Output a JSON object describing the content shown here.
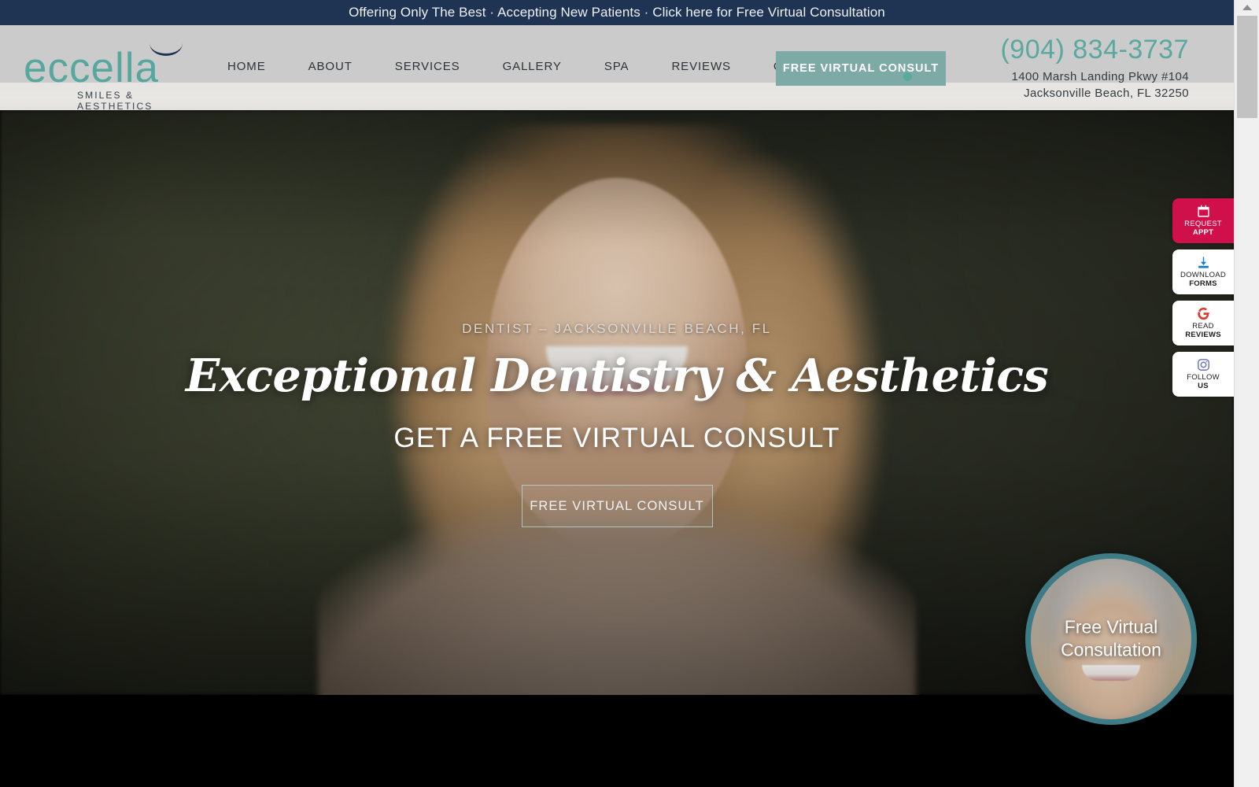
{
  "announcement": {
    "text": "Offering Only The Best · Accepting New Patients · Click here for Free Virtual Consultation"
  },
  "brand": {
    "name": "eccella",
    "tagline": "SMILES & AESTHETICS"
  },
  "nav": {
    "items": [
      {
        "label": "HOME"
      },
      {
        "label": "ABOUT"
      },
      {
        "label": "SERVICES"
      },
      {
        "label": "GALLERY"
      },
      {
        "label": "SPA"
      },
      {
        "label": "REVIEWS"
      },
      {
        "label": "CONTACT"
      }
    ],
    "cta_label": "FREE VIRTUAL CONSULT"
  },
  "contact": {
    "phone": "(904) 834-3737",
    "address_line1": "1400 Marsh Landing Pkwy #104",
    "address_line2": "Jacksonville Beach, FL 32250"
  },
  "hero": {
    "eyebrow": "DENTIST – JACKSONVILLE BEACH, FL",
    "headline": "Exceptional Dentistry & Aesthetics",
    "subheading": "GET A FREE VIRTUAL CONSULT",
    "cta_label": "FREE VIRTUAL CONSULT"
  },
  "rail": {
    "items": [
      {
        "icon": "calendar-icon",
        "line1": "REQUEST",
        "line2": "APPT",
        "style": "crimson"
      },
      {
        "icon": "download-icon",
        "line1": "DOWNLOAD",
        "line2": "FORMS",
        "style": "white"
      },
      {
        "icon": "google-g-icon",
        "line1": "READ",
        "line2": "REVIEWS",
        "style": "white"
      },
      {
        "icon": "instagram-icon",
        "line1": "FOLLOW",
        "line2": "US",
        "style": "white"
      }
    ]
  },
  "badge": {
    "line1": "Free Virtual",
    "line2": "Consultation"
  },
  "colors": {
    "navy": "#1f3353",
    "teal": "#7daaa4",
    "teal_text": "#5aa89e",
    "crimson": "#d0104a",
    "badge_ring": "#3d7b86",
    "header_gray": "#cbcbcb",
    "download_blue": "#1a7ec2",
    "google_red": "#e03a2f",
    "instagram_purple": "#6a72b8"
  }
}
